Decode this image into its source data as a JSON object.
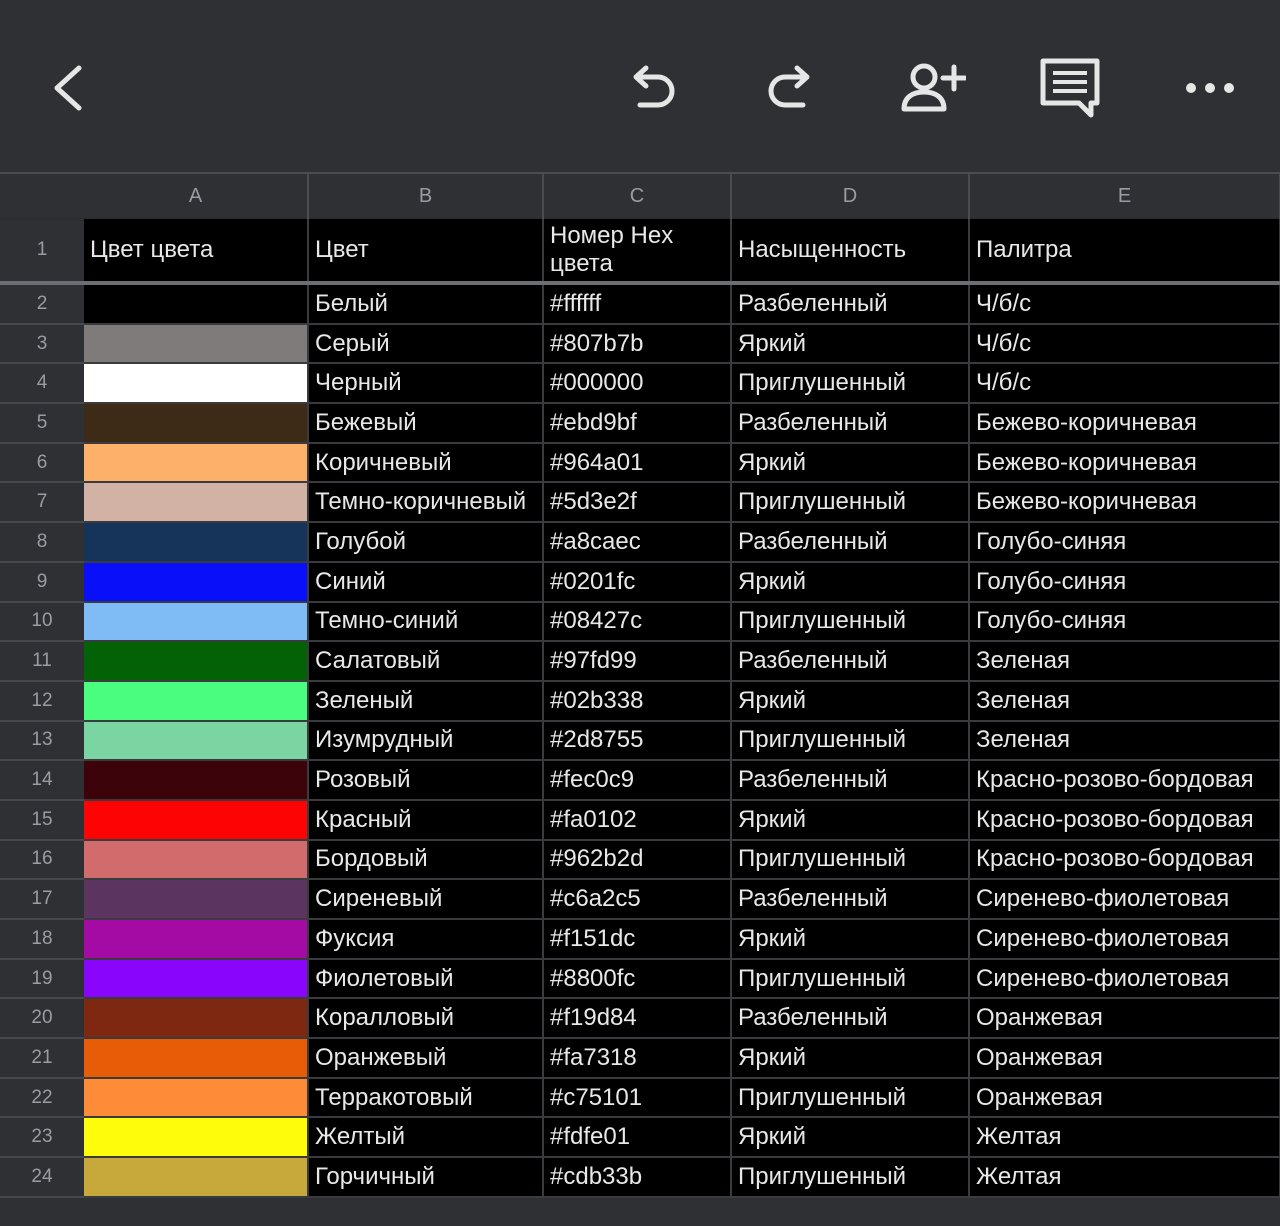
{
  "toolbar": {
    "back_icon": "chevron-left-icon",
    "undo_icon": "undo-icon",
    "redo_icon": "redo-icon",
    "share_icon": "add-person-icon",
    "comment_icon": "comment-icon",
    "more_icon": "more-horizontal-icon"
  },
  "columns": [
    "A",
    "B",
    "C",
    "D",
    "E"
  ],
  "header_row": {
    "number": "1",
    "cells": [
      "Цвет цвета",
      "Цвет",
      "Номер Hex цвета",
      "Насыщенность",
      "Палитра"
    ]
  },
  "rows": [
    {
      "n": "2",
      "swatch": "#000000",
      "name": "Белый",
      "hex": "#ffffff",
      "saturation": "Разбеленный",
      "palette": "Ч/б/с"
    },
    {
      "n": "3",
      "swatch": "#807b7b",
      "name": "Серый",
      "hex": "#807b7b",
      "saturation": "Яркий",
      "palette": "Ч/б/с"
    },
    {
      "n": "4",
      "swatch": "#ffffff",
      "name": "Черный",
      "hex": "#000000",
      "saturation": "Приглушенный",
      "palette": "Ч/б/с"
    },
    {
      "n": "5",
      "swatch": "#3d2a17",
      "name": "Бежевый",
      "hex": "#ebd9bf",
      "saturation": "Разбеленный",
      "palette": "Бежево-коричневая"
    },
    {
      "n": "6",
      "swatch": "#fdb06a",
      "name": "Коричневый",
      "hex": "#964a01",
      "saturation": "Яркий",
      "palette": "Бежево-коричневая"
    },
    {
      "n": "7",
      "swatch": "#d2b2a5",
      "name": "Темно-коричневый",
      "hex": "#5d3e2f",
      "saturation": "Приглушенный",
      "palette": "Бежево-коричневая"
    },
    {
      "n": "8",
      "swatch": "#16335a",
      "name": "Голубой",
      "hex": "#a8caec",
      "saturation": "Разбеленный",
      "palette": "Голубо-синяя"
    },
    {
      "n": "9",
      "swatch": "#0a0ffa",
      "name": "Синий",
      "hex": "#0201fc",
      "saturation": "Яркий",
      "palette": "Голубо-синяя"
    },
    {
      "n": "10",
      "swatch": "#7fbcf6",
      "name": "Темно-синий",
      "hex": "#08427c",
      "saturation": "Приглушенный",
      "palette": "Голубо-синяя"
    },
    {
      "n": "11",
      "swatch": "#036106",
      "name": "Салатовый",
      "hex": "#97fd99",
      "saturation": "Разбеленный",
      "palette": "Зеленая"
    },
    {
      "n": "12",
      "swatch": "#4afd7f",
      "name": "Зеленый",
      "hex": "#02b338",
      "saturation": "Яркий",
      "palette": "Зеленая"
    },
    {
      "n": "13",
      "swatch": "#7bd5a2",
      "name": "Изумрудный",
      "hex": "#2d8755",
      "saturation": "Приглушенный",
      "palette": "Зеленая"
    },
    {
      "n": "14",
      "swatch": "#3d030b",
      "name": "Розовый",
      "hex": "#fec0c9",
      "saturation": "Разбеленный",
      "palette": "Красно-розово-бордовая"
    },
    {
      "n": "15",
      "swatch": "#fe0303",
      "name": "Красный",
      "hex": "#fa0102",
      "saturation": "Яркий",
      "palette": "Красно-розово-бордовая"
    },
    {
      "n": "16",
      "swatch": "#d26b6c",
      "name": "Бордовый",
      "hex": "#962b2d",
      "saturation": "Приглушенный",
      "palette": "Красно-розово-бордовая"
    },
    {
      "n": "17",
      "swatch": "#5b3560",
      "name": "Сиреневый",
      "hex": "#c6a2c5",
      "saturation": "Разбеленный",
      "palette": "Сиренево-фиолетовая"
    },
    {
      "n": "18",
      "swatch": "#a40aa4",
      "name": "Фуксия",
      "hex": "#f151dc",
      "saturation": "Яркий",
      "palette": "Сиренево-фиолетовая"
    },
    {
      "n": "19",
      "swatch": "#8a05fc",
      "name": "Фиолетовый",
      "hex": "#8800fc",
      "saturation": "Приглушенный",
      "palette": "Сиренево-фиолетовая"
    },
    {
      "n": "20",
      "swatch": "#7e2811",
      "name": "Коралловый",
      "hex": "#f19d84",
      "saturation": "Разбеленный",
      "palette": "Оранжевая"
    },
    {
      "n": "21",
      "swatch": "#e75d07",
      "name": "Оранжевый",
      "hex": "#fa7318",
      "saturation": "Яркий",
      "palette": "Оранжевая"
    },
    {
      "n": "22",
      "swatch": "#fd8b37",
      "name": "Терракотовый",
      "hex": "#c75101",
      "saturation": "Приглушенный",
      "palette": "Оранжевая"
    },
    {
      "n": "23",
      "swatch": "#fefc0b",
      "name": "Желтый",
      "hex": "#fdfe01",
      "saturation": "Яркий",
      "palette": "Желтая"
    },
    {
      "n": "24",
      "swatch": "#c7a93b",
      "name": "Горчичный",
      "hex": "#cdb33b",
      "saturation": "Приглушенный",
      "palette": "Желтая"
    }
  ]
}
